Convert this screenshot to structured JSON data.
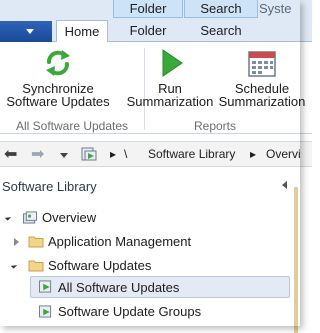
{
  "context_tabs": {
    "folder_tools": "Folder Tools",
    "search_tools": "Search Tools",
    "window_title_fragment": "Syste"
  },
  "ribbon_tabs": {
    "home": "Home",
    "folder": "Folder",
    "search": "Search"
  },
  "ribbon": {
    "sync_line1": "Synchronize",
    "sync_line2": "Software Updates",
    "run_line1": "Run",
    "run_line2": "Summarization",
    "sched_line1": "Schedule",
    "sched_line2": "Summarization",
    "group_software_updates": "All Software Updates",
    "group_reports": "Reports"
  },
  "navigation": {
    "back_glyph": "⬅",
    "forward_glyph": "➡",
    "separator": "\\",
    "crumb_separator": "▸",
    "crumb_library": "Software Library",
    "crumb_overview": "Overvi"
  },
  "pane": {
    "title": "Software Library",
    "tree": [
      {
        "label": "Overview"
      },
      {
        "label": "Application Management"
      },
      {
        "label": "Software Updates"
      },
      {
        "label": "All Software Updates"
      },
      {
        "label": "Software Update Groups"
      }
    ]
  },
  "colors": {
    "accent": "#1b4a9a",
    "ribbon_bg": "#dfe9f5",
    "selection": "#e4eaf3",
    "icon_green": "#3aa83a"
  },
  "icons": [
    "file-menu-arrow-icon",
    "sync-arrows-icon",
    "run-play-icon",
    "calendar-schedule-icon",
    "back-arrow-icon",
    "forward-arrow-icon",
    "home-node-icon",
    "overview-icon",
    "folder-icon",
    "software-updates-icon"
  ]
}
